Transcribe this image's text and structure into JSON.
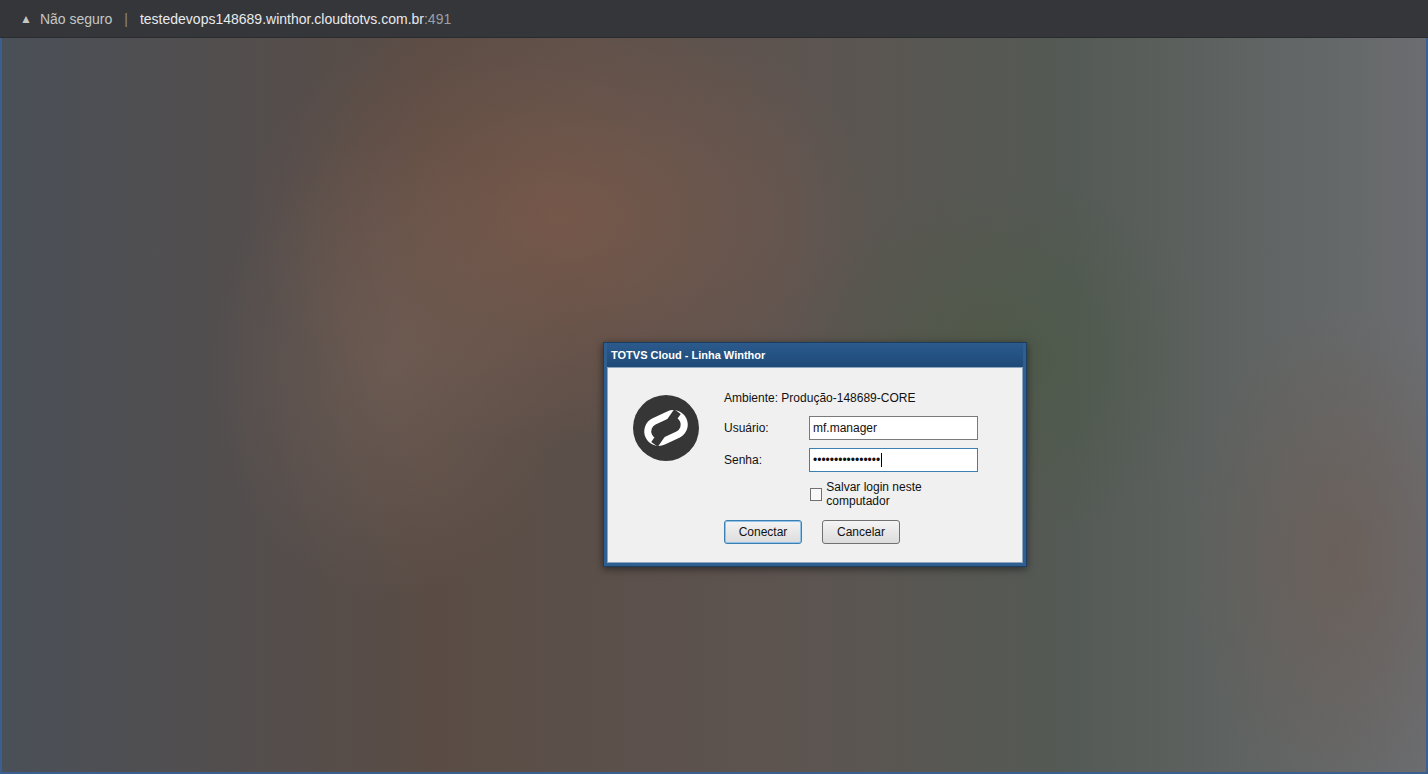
{
  "browser": {
    "security_icon": "▲",
    "security_label": "Não seguro",
    "separator": "|",
    "url_host": "testedevops148689.winthor.cloudtotvs.com.br",
    "url_port": ":491"
  },
  "dialog": {
    "title": "TOTVS Cloud - Linha Winthor",
    "environment": "Ambiente: Produção-148689-CORE",
    "fields": [
      {
        "label": "Usuário:",
        "value": "mf.manager",
        "focused": false
      },
      {
        "label": "Senha:",
        "value": "••••••••••••••••",
        "focused": true
      }
    ],
    "save_login": {
      "label": "Salvar login neste computador",
      "checked": false
    },
    "buttons": [
      {
        "label": "Conectar",
        "default": true
      },
      {
        "label": "Cancelar",
        "default": false
      }
    ]
  }
}
